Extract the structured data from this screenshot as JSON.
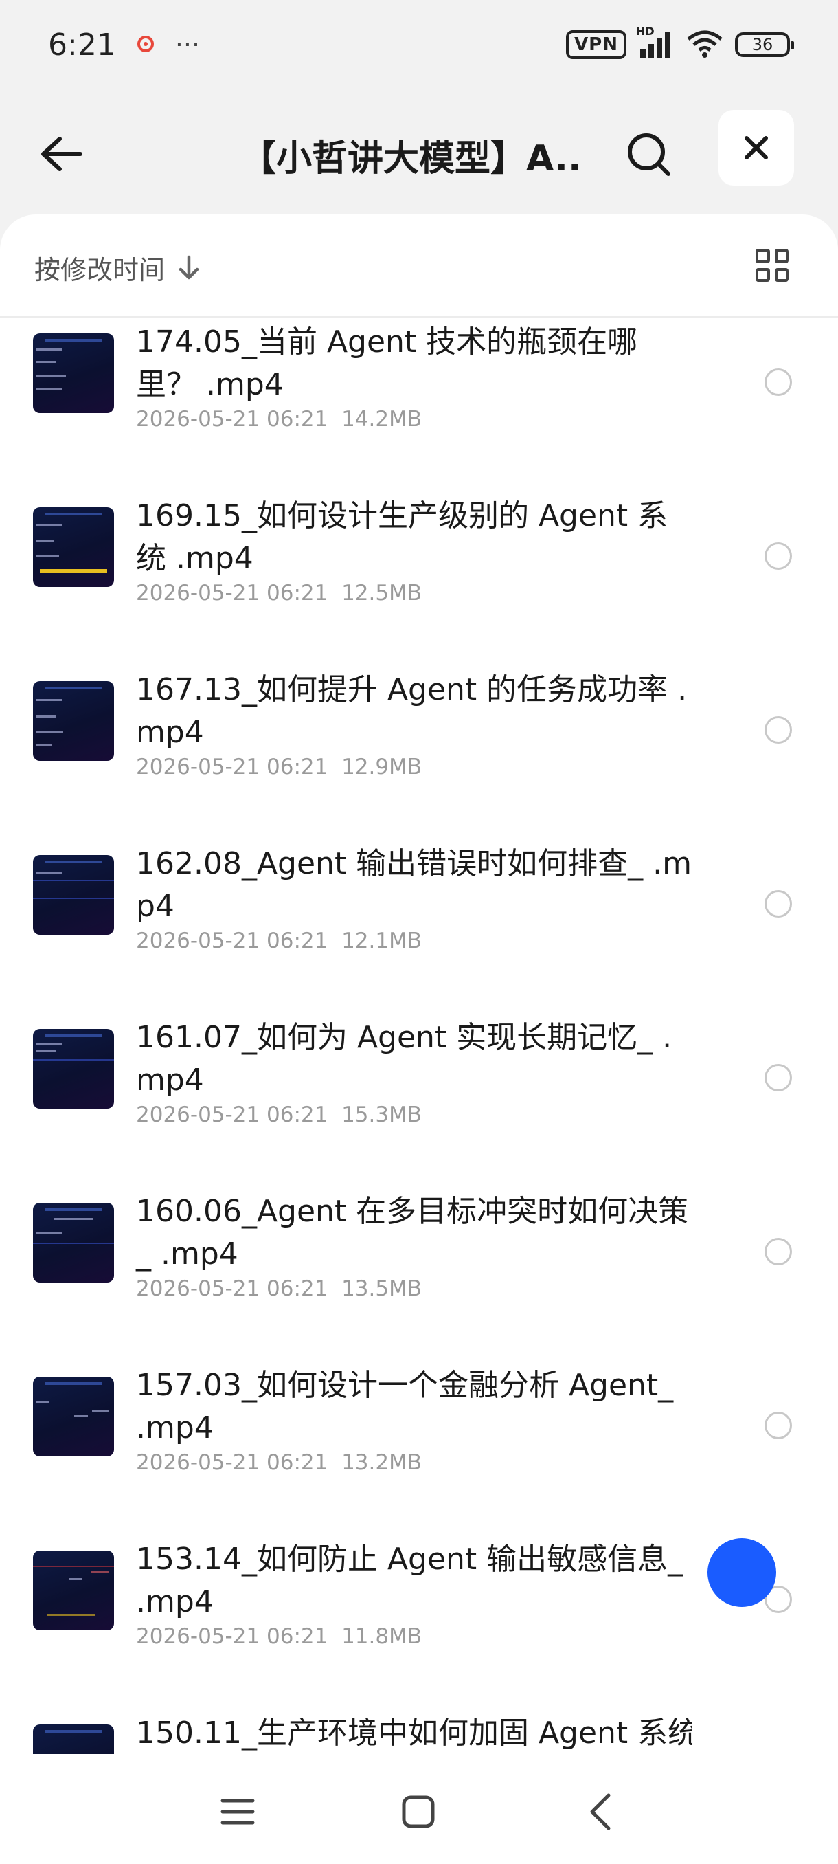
{
  "status_bar": {
    "time": "6:21",
    "dots": "···",
    "vpn": "VPN",
    "network": "HD",
    "battery": "36"
  },
  "header": {
    "title": "【小哲讲大模型】A..."
  },
  "sort": {
    "label": "按修改时间"
  },
  "files": [
    {
      "name": "174.05_当前 Agent 技术的瓶颈在哪里？ .mp4",
      "date": "2026-05-21 06:21",
      "size": "14.2MB"
    },
    {
      "name": "169.15_如何设计生产级别的 Agent 系统 .mp4",
      "date": "2026-05-21 06:21",
      "size": "12.5MB"
    },
    {
      "name": "167.13_如何提升 Agent 的任务成功率 .mp4",
      "date": "2026-05-21 06:21",
      "size": "12.9MB"
    },
    {
      "name": "162.08_Agent 输出错误时如何排查_ .mp4",
      "date": "2026-05-21 06:21",
      "size": "12.1MB"
    },
    {
      "name": "161.07_如何为 Agent 实现长期记忆_ .mp4",
      "date": "2026-05-21 06:21",
      "size": "15.3MB"
    },
    {
      "name": "160.06_Agent 在多目标冲突时如何决策_ .mp4",
      "date": "2026-05-21 06:21",
      "size": "13.5MB"
    },
    {
      "name": "157.03_如何设计一个金融分析 Agent_ .mp4",
      "date": "2026-05-21 06:21",
      "size": "13.2MB"
    },
    {
      "name": "153.14_如何防止 Agent 输出敏感信息_ .mp4",
      "date": "2026-05-21 06:21",
      "size": "11.8MB"
    },
    {
      "name": "150.11_生产环境中如何加固 Agent 系统",
      "date": "",
      "size": ""
    }
  ]
}
